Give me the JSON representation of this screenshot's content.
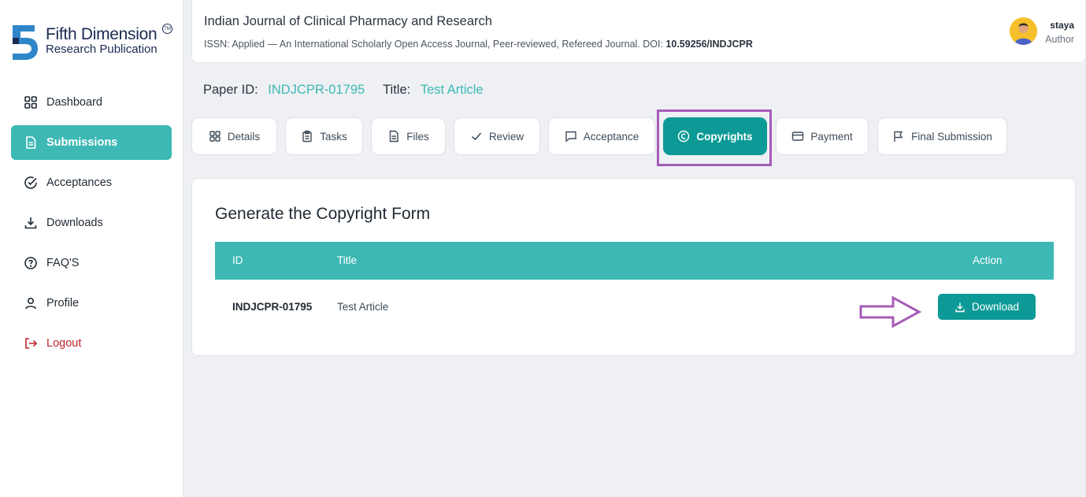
{
  "logo": {
    "line1": "Fifth Dimension",
    "line2": "Research Publication",
    "tm": "TM"
  },
  "sidebar": {
    "items": [
      {
        "label": "Dashboard",
        "icon": "grid-icon"
      },
      {
        "label": "Submissions",
        "icon": "document-icon",
        "active": true
      },
      {
        "label": "Acceptances",
        "icon": "check-circle-icon"
      },
      {
        "label": "Downloads",
        "icon": "download-icon"
      },
      {
        "label": "FAQ'S",
        "icon": "question-circle-icon"
      },
      {
        "label": "Profile",
        "icon": "user-icon"
      },
      {
        "label": "Logout",
        "icon": "logout-icon"
      }
    ]
  },
  "header": {
    "journal_title": "Indian Journal of Clinical Pharmacy and Research",
    "journal_sub": "ISSN: Applied — An International Scholarly Open Access Journal, Peer-reviewed, Refereed Journal. DOI: ",
    "doi": "10.59256/INDJCPR",
    "user_name": "staya",
    "user_role": "Author"
  },
  "paper": {
    "id_label": "Paper ID:",
    "id_value": "INDJCPR-01795",
    "title_label": "Title:",
    "title_value": "Test Article"
  },
  "tabs": [
    {
      "label": "Details",
      "icon": "grid-icon"
    },
    {
      "label": "Tasks",
      "icon": "clipboard-icon"
    },
    {
      "label": "Files",
      "icon": "file-icon"
    },
    {
      "label": "Review",
      "icon": "check-icon"
    },
    {
      "label": "Acceptance",
      "icon": "message-icon"
    },
    {
      "label": "Copyrights",
      "icon": "copyright-icon",
      "active": true
    },
    {
      "label": "Payment",
      "icon": "card-icon"
    },
    {
      "label": "Final Submission",
      "icon": "flag-icon"
    }
  ],
  "card": {
    "title": "Generate the Copyright Form",
    "columns": {
      "id": "ID",
      "title": "Title",
      "action": "Action"
    },
    "rows": [
      {
        "id": "INDJCPR-01795",
        "title": "Test Article",
        "action_label": "Download"
      }
    ]
  },
  "colors": {
    "accent": "#3db8b4",
    "accent_dark": "#0d9a96",
    "highlight": "#a55cb7",
    "logout": "#c0262d"
  }
}
